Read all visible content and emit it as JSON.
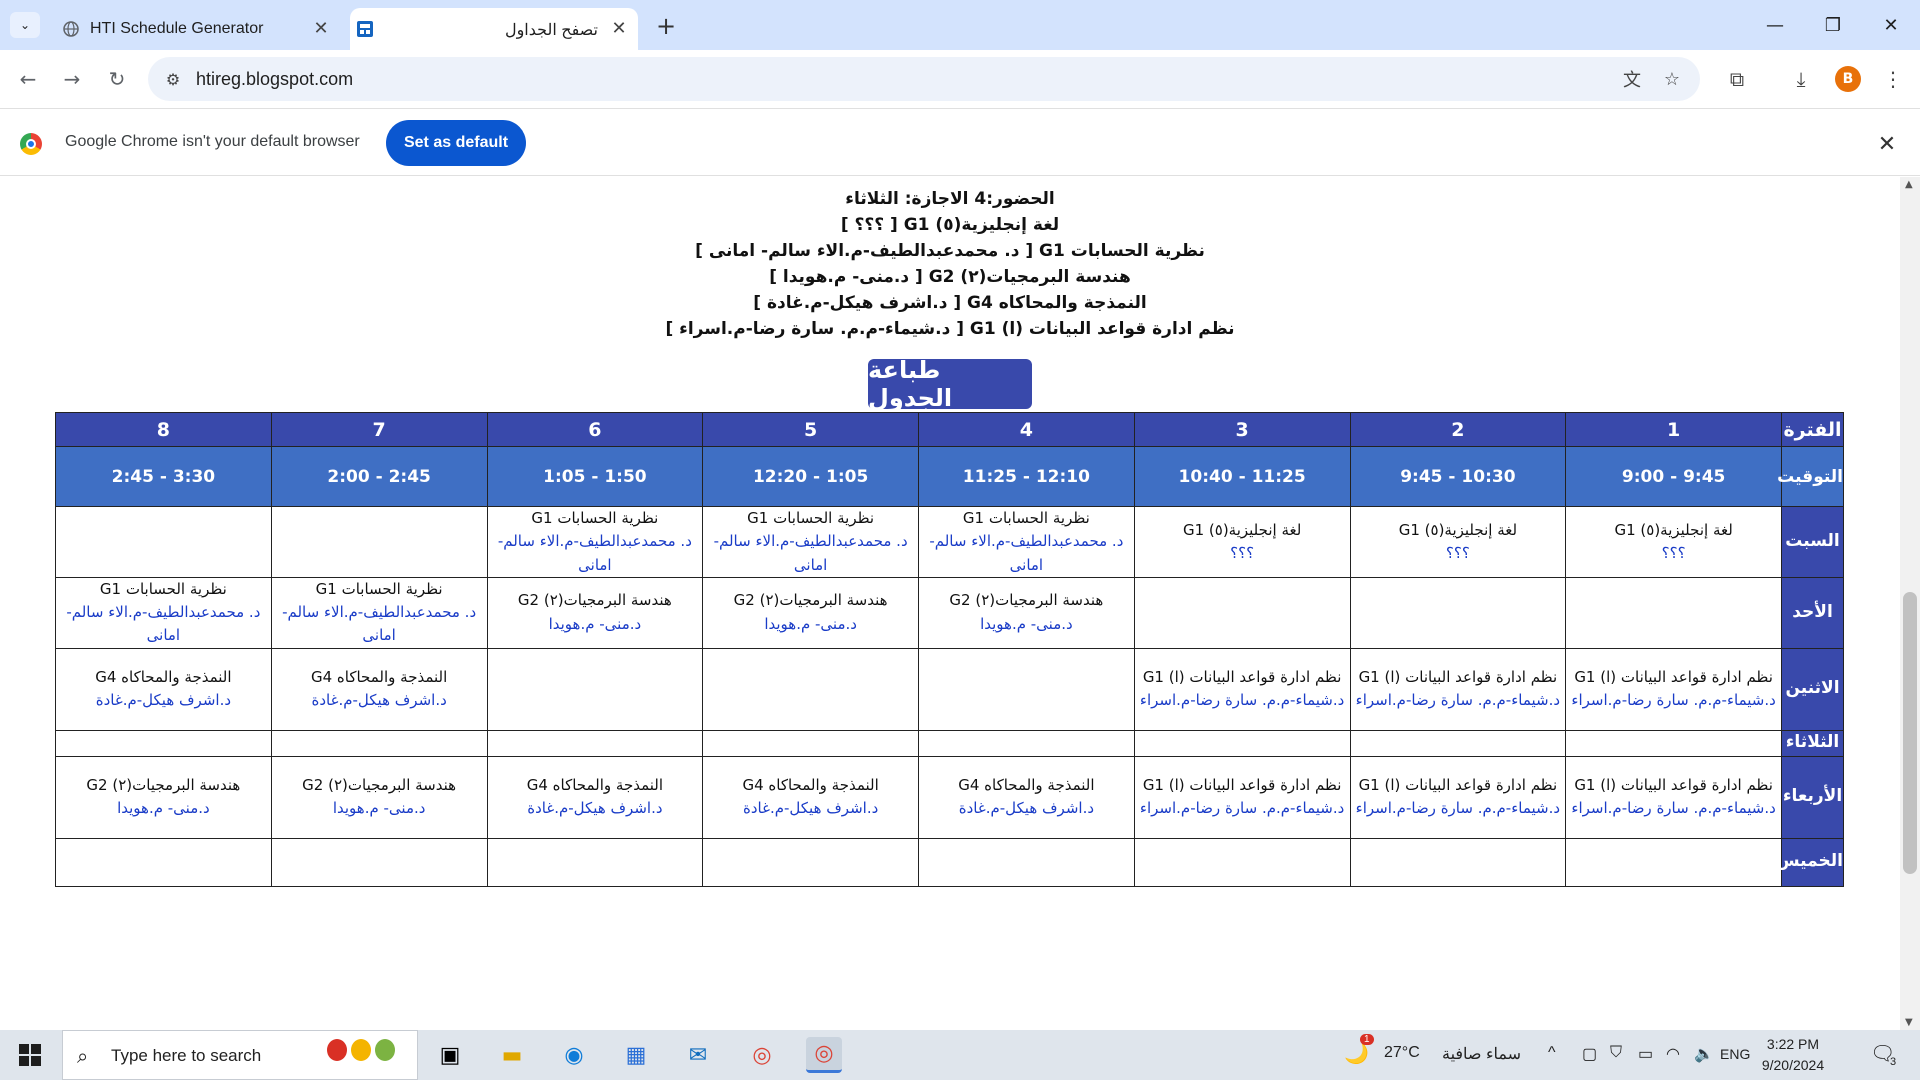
{
  "browser": {
    "tabs": [
      {
        "title": "HTI Schedule Generator",
        "active": false
      },
      {
        "title": "تصفح الجداول",
        "active": true
      }
    ],
    "url": "htireg.blogspot.com",
    "profile_initial": "B",
    "infobar": {
      "message": "Google Chrome isn't your default browser",
      "button": "Set as default"
    }
  },
  "page": {
    "summary_lines": [
      "الحضور:4 الاجازة: الثلاثاء",
      "لغة إنجليزية(٥) G1 [ ؟؟؟ ]",
      "نظرية الحسابات G1 [ د. محمدعبدالطيف-م.الاء سالم- امانى ]",
      "هندسة البرمجيات(٢) G2 [ د.منى- م.هويدا ]",
      "النمذجة والمحاكاه G4 [ د.اشرف هيكل-م.غادة ]",
      "نظم ادارة قواعد البيانات (ا) G1 [ د.شيماء-م.م. سارة رضا-م.اسراء ]"
    ],
    "print_button": "طباعة الجدول",
    "schedule": {
      "period_header": "الفترة",
      "time_header": "التوقيت",
      "periods": [
        "1",
        "2",
        "3",
        "4",
        "5",
        "6",
        "7",
        "8"
      ],
      "times": [
        "9:45 - 9:00",
        "10:30 - 9:45",
        "11:25 - 10:40",
        "12:10 - 11:25",
        "1:05 - 12:20",
        "1:50 - 1:05",
        "2:45 - 2:00",
        "3:30 - 2:45"
      ],
      "days": [
        {
          "name": "السبت",
          "cells": [
            {
              "subject": "لغة إنجليزية(٥) G1",
              "instructor": "؟؟؟"
            },
            {
              "subject": "لغة إنجليزية(٥) G1",
              "instructor": "؟؟؟"
            },
            {
              "subject": "لغة إنجليزية(٥) G1",
              "instructor": "؟؟؟"
            },
            {
              "subject": "نظرية الحسابات G1",
              "instructor": "د. محمدعبدالطيف-م.الاء سالم- امانى"
            },
            {
              "subject": "نظرية الحسابات G1",
              "instructor": "د. محمدعبدالطيف-م.الاء سالم- امانى"
            },
            {
              "subject": "نظرية الحسابات G1",
              "instructor": "د. محمدعبدالطيف-م.الاء سالم- امانى"
            },
            {
              "subject": "",
              "instructor": ""
            },
            {
              "subject": "",
              "instructor": ""
            }
          ]
        },
        {
          "name": "الأحد",
          "cells": [
            {
              "subject": "",
              "instructor": ""
            },
            {
              "subject": "",
              "instructor": ""
            },
            {
              "subject": "",
              "instructor": ""
            },
            {
              "subject": "هندسة البرمجيات(٢) G2",
              "instructor": "د.منى- م.هويدا"
            },
            {
              "subject": "هندسة البرمجيات(٢) G2",
              "instructor": "د.منى- م.هويدا"
            },
            {
              "subject": "هندسة البرمجيات(٢) G2",
              "instructor": "د.منى- م.هويدا"
            },
            {
              "subject": "نظرية الحسابات G1",
              "instructor": "د. محمدعبدالطيف-م.الاء سالم- امانى"
            },
            {
              "subject": "نظرية الحسابات G1",
              "instructor": "د. محمدعبدالطيف-م.الاء سالم- امانى"
            }
          ]
        },
        {
          "name": "الاثنين",
          "cells": [
            {
              "subject": "نظم ادارة قواعد البيانات (ا) G1",
              "instructor": "د.شيماء-م.م. سارة رضا-م.اسراء"
            },
            {
              "subject": "نظم ادارة قواعد البيانات (ا) G1",
              "instructor": "د.شيماء-م.م. سارة رضا-م.اسراء"
            },
            {
              "subject": "نظم ادارة قواعد البيانات (ا) G1",
              "instructor": "د.شيماء-م.م. سارة رضا-م.اسراء"
            },
            {
              "subject": "",
              "instructor": ""
            },
            {
              "subject": "",
              "instructor": ""
            },
            {
              "subject": "",
              "instructor": ""
            },
            {
              "subject": "النمذجة والمحاكاه G4",
              "instructor": "د.اشرف هيكل-م.غادة"
            },
            {
              "subject": "النمذجة والمحاكاه G4",
              "instructor": "د.اشرف هيكل-م.غادة"
            }
          ]
        },
        {
          "name": "الثلاثاء",
          "cells": [
            {
              "subject": "",
              "instructor": ""
            },
            {
              "subject": "",
              "instructor": ""
            },
            {
              "subject": "",
              "instructor": ""
            },
            {
              "subject": "",
              "instructor": ""
            },
            {
              "subject": "",
              "instructor": ""
            },
            {
              "subject": "",
              "instructor": ""
            },
            {
              "subject": "",
              "instructor": ""
            },
            {
              "subject": "",
              "instructor": ""
            }
          ]
        },
        {
          "name": "الأربعاء",
          "cells": [
            {
              "subject": "نظم ادارة قواعد البيانات (ا) G1",
              "instructor": "د.شيماء-م.م. سارة رضا-م.اسراء"
            },
            {
              "subject": "نظم ادارة قواعد البيانات (ا) G1",
              "instructor": "د.شيماء-م.م. سارة رضا-م.اسراء"
            },
            {
              "subject": "نظم ادارة قواعد البيانات (ا) G1",
              "instructor": "د.شيماء-م.م. سارة رضا-م.اسراء"
            },
            {
              "subject": "النمذجة والمحاكاه G4",
              "instructor": "د.اشرف هيكل-م.غادة"
            },
            {
              "subject": "النمذجة والمحاكاه G4",
              "instructor": "د.اشرف هيكل-م.غادة"
            },
            {
              "subject": "النمذجة والمحاكاه G4",
              "instructor": "د.اشرف هيكل-م.غادة"
            },
            {
              "subject": "هندسة البرمجيات(٢) G2",
              "instructor": "د.منى- م.هويدا"
            },
            {
              "subject": "هندسة البرمجيات(٢) G2",
              "instructor": "د.منى- م.هويدا"
            }
          ]
        },
        {
          "name": "الخميس",
          "cells": [
            {
              "subject": "",
              "instructor": ""
            },
            {
              "subject": "",
              "instructor": ""
            },
            {
              "subject": "",
              "instructor": ""
            },
            {
              "subject": "",
              "instructor": ""
            },
            {
              "subject": "",
              "instructor": ""
            },
            {
              "subject": "",
              "instructor": ""
            },
            {
              "subject": "",
              "instructor": ""
            },
            {
              "subject": "",
              "instructor": ""
            }
          ]
        }
      ]
    }
  },
  "taskbar": {
    "search_placeholder": "Type here to search",
    "weather_temp": "27°C",
    "weather_desc": "سماء صافية",
    "weather_badge": "1",
    "language": "ENG",
    "time": "3:22 PM",
    "date": "9/20/2024",
    "notification_count": "3"
  },
  "colors": {
    "table_header": "#3949ab",
    "time_row": "#3f6fc4",
    "instructor_text": "#1a3cc7",
    "tabstrip": "#d3e3fd"
  }
}
